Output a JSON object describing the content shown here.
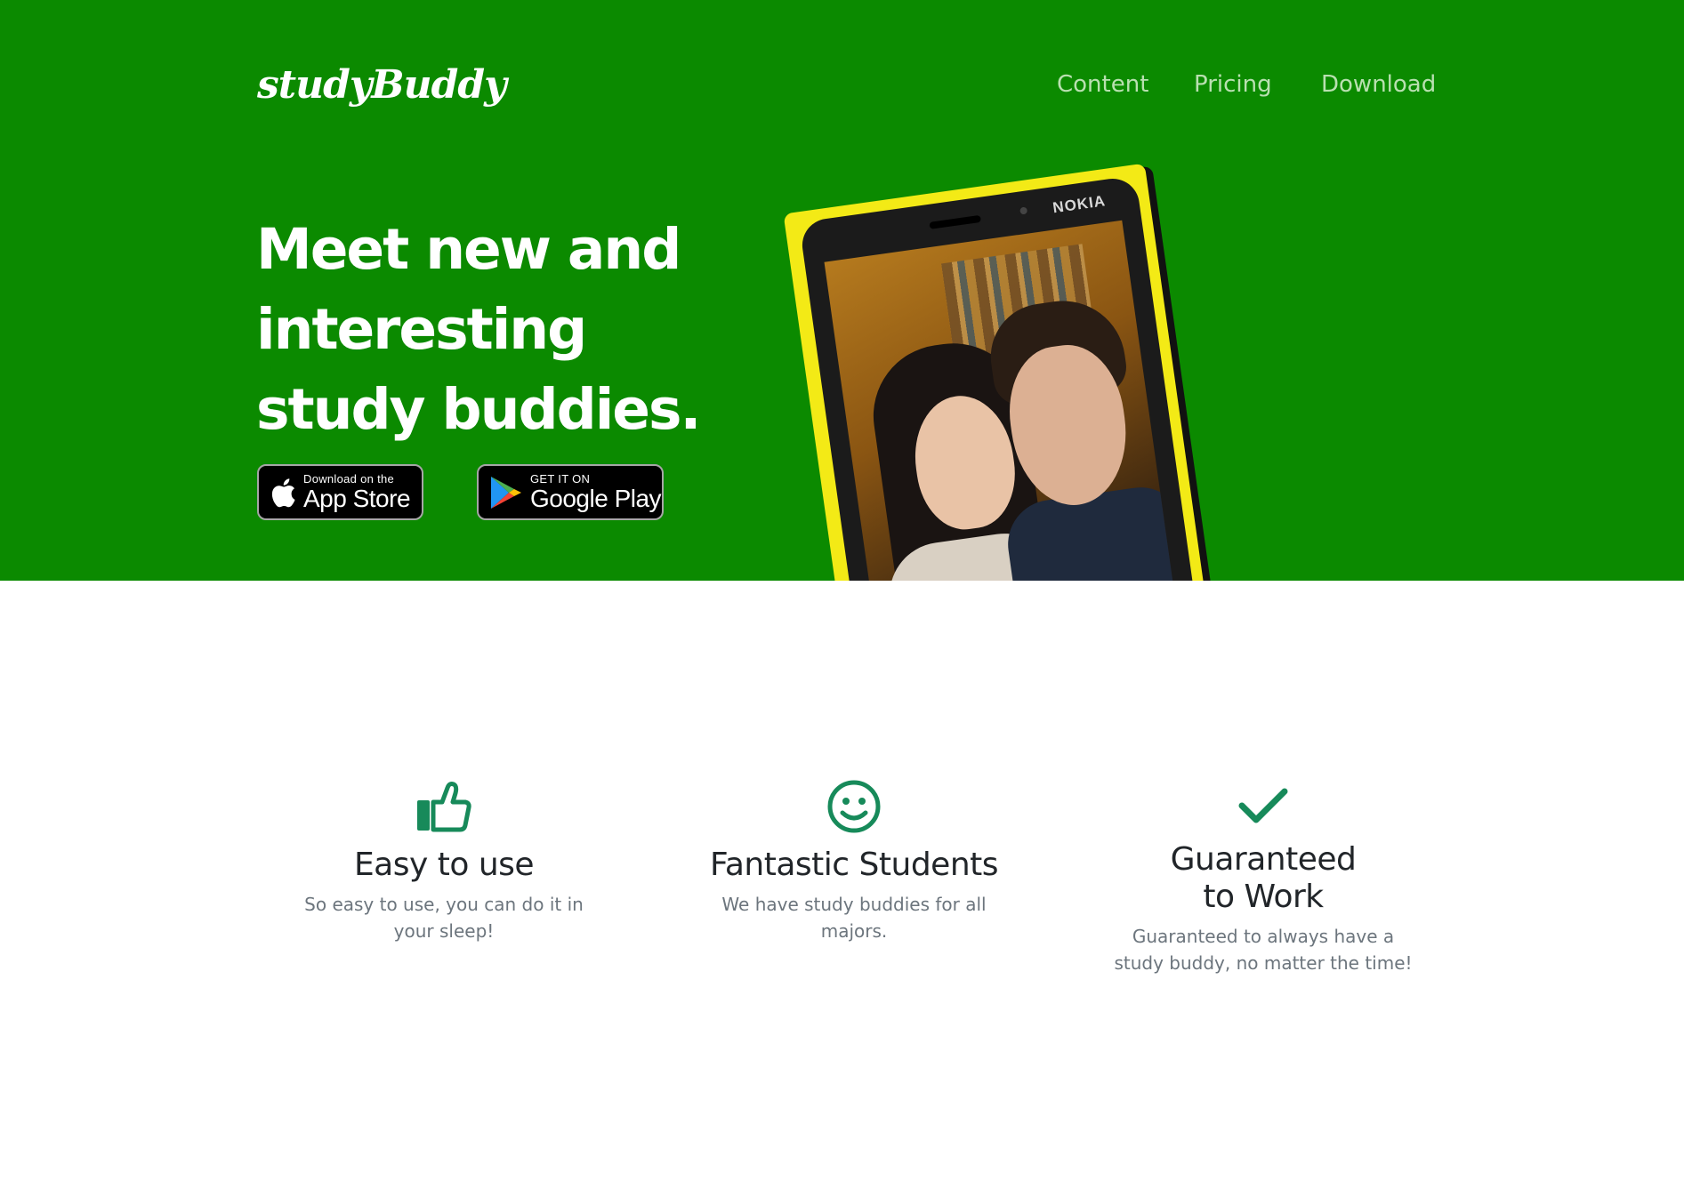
{
  "header": {
    "brand": "studyBuddy",
    "nav": [
      {
        "label": "Content"
      },
      {
        "label": "Pricing"
      },
      {
        "label": "Download"
      }
    ]
  },
  "hero": {
    "headline": "Meet new and interesting study buddies.",
    "app_store": {
      "small": "Download on the",
      "big": "App Store"
    },
    "google_play": {
      "small": "GET IT ON",
      "big": "Google Play"
    },
    "phone_brand": "NOKIA"
  },
  "features": [
    {
      "icon": "thumbs-up-icon",
      "title": "Easy to use",
      "desc": "So easy to use, you can do it in your sleep!"
    },
    {
      "icon": "smiley-face-icon",
      "title": "Fantastic Students",
      "desc": "We have study buddies for all majors."
    },
    {
      "icon": "checkmark-icon",
      "title": "Guaranteed to Work",
      "desc": "Guaranteed to always have a study buddy, no matter the time!"
    }
  ],
  "colors": {
    "hero_bg": "#0b8a00",
    "accent": "#178a5a",
    "nav_text": "#b9e0b0"
  }
}
